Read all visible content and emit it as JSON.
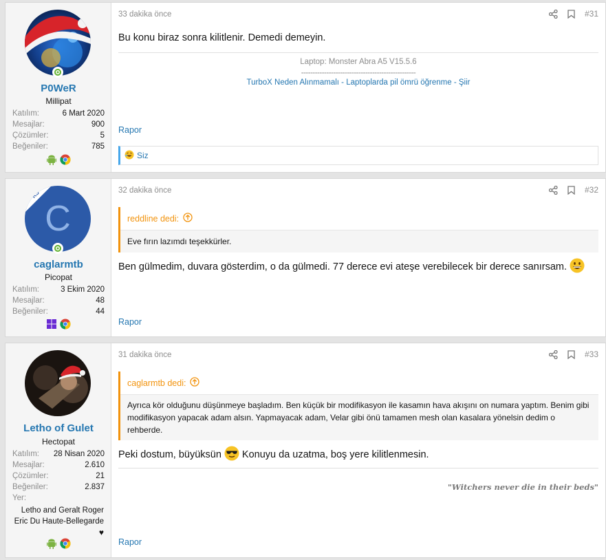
{
  "posts": [
    {
      "author": "P0WeR",
      "user_title": "Millipat",
      "stats": [
        {
          "label": "Katılım:",
          "value": "6 Mart 2020"
        },
        {
          "label": "Mesajlar:",
          "value": "900"
        },
        {
          "label": "Çözümler:",
          "value": "5"
        },
        {
          "label": "Beğeniler:",
          "value": "785"
        }
      ],
      "time": "33 dakika önce",
      "number": "#31",
      "body": "Bu konu biraz sonra kilitlenir. Demedi demeyin.",
      "signature": {
        "line1": "Laptop: Monster Abra A5 V15.5.6",
        "divider": "--------------------------------------------------",
        "links": "TurboX Neden Alınmamalı - Laptoplarda pil ömrü öğrenme - Şiir"
      },
      "report": "Rapor",
      "reaction": "Siz",
      "icons": [
        "android-icon",
        "chrome-icon"
      ]
    },
    {
      "author": "caglarmtb",
      "user_title": "Picopat",
      "avatar_letter": "C",
      "avatar_badge": "KS",
      "stats": [
        {
          "label": "Katılım:",
          "value": "3 Ekim 2020"
        },
        {
          "label": "Mesajlar:",
          "value": "48"
        },
        {
          "label": "Beğeniler:",
          "value": "44"
        }
      ],
      "time": "32 dakika önce",
      "number": "#32",
      "quote_author": "reddline dedi:",
      "quote_body": "Eve fırın lazımdı teşekkürler.",
      "body": "Ben gülmedim, duvara gösterdim, o da gülmedi. 77 derece evi ateşe verebilecek bir derece sanırsam.",
      "report": "Rapor",
      "icons": [
        "windows-icon",
        "chrome-icon"
      ]
    },
    {
      "author": "Letho of Gulet",
      "user_title": "Hectopat",
      "stats": [
        {
          "label": "Katılım:",
          "value": "28 Nisan 2020"
        },
        {
          "label": "Mesajlar:",
          "value": "2.610"
        },
        {
          "label": "Çözümler:",
          "value": "21"
        },
        {
          "label": "Beğeniler:",
          "value": "2.837"
        },
        {
          "label": "Yer:",
          "value": ""
        }
      ],
      "location": "Letho and Geralt Roger Eric Du Haute-Bellegarde",
      "location_line1": "Letho and Geralt Roger",
      "location_line2": "Eric Du Haute-Bellegarde",
      "location_icon": "♥",
      "time": "31 dakika önce",
      "number": "#33",
      "quote_author": "caglarmtb dedi:",
      "quote_body": "Ayrıca kör olduğunu düşünmeye başladım. Ben küçük bir modifikasyon ile kasamın hava akışını on numara yaptım. Benim gibi modifikasyon yapacak adam alsın. Yapmayacak adam, Velar gibi önü tamamen mesh olan kasalara yönelsin dedim o rehberde.",
      "body_part1": "Peki dostum, büyüksün",
      "body_part2": "Konuyu da uzatma, boş yere kilitlenmesin.",
      "signature": "\"Witchers never die in their beds\"",
      "report": "Rapor",
      "icons": [
        "android-icon",
        "chrome-icon"
      ]
    }
  ],
  "colors": {
    "link": "#2577b1",
    "quote_accent": "#f2930d",
    "online": "#63b331",
    "muted": "#8c8c8c"
  }
}
